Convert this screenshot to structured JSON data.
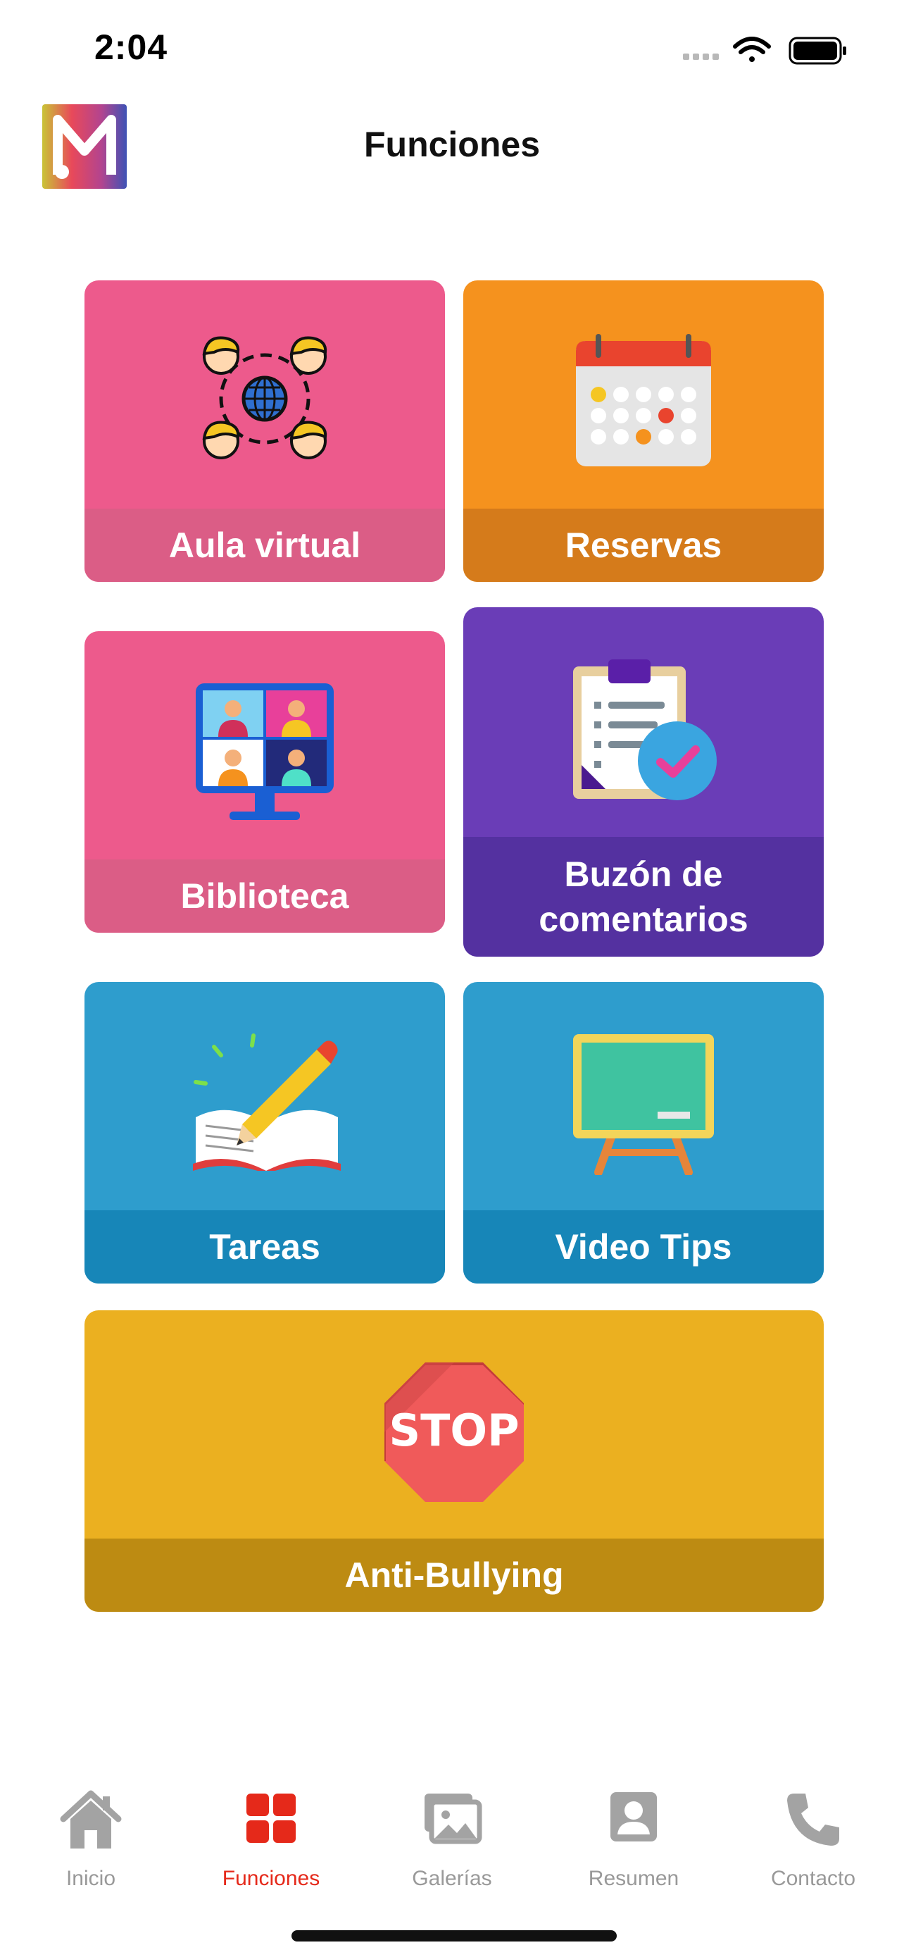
{
  "status_bar": {
    "time": "2:04",
    "icons": [
      "signal-icon",
      "wifi-icon",
      "battery-icon"
    ]
  },
  "header": {
    "title": "Funciones",
    "logo_letter": "M"
  },
  "tiles": [
    {
      "label": "Aula virtual",
      "color": "#ED5A8C",
      "band_color": "#DB5D86",
      "icon": "virtual-classroom-icon"
    },
    {
      "label": "Reservas",
      "color": "#F5921E",
      "band_color": "#D57B1B",
      "icon": "calendar-icon"
    },
    {
      "label": "Biblioteca",
      "color": "#ED5A8C",
      "band_color": "#DB5D86",
      "icon": "video-conference-icon"
    },
    {
      "label_line1": "Buzón de",
      "label_line2": "comentarios",
      "color": "#6A3DB7",
      "band_color": "#5431A0",
      "icon": "clipboard-check-icon"
    },
    {
      "label": "Tareas",
      "color": "#2E9DCD",
      "band_color": "#1786B8",
      "icon": "book-pencil-icon"
    },
    {
      "label": "Video Tips",
      "color": "#2E9DCD",
      "band_color": "#1786B8",
      "icon": "chalkboard-icon"
    },
    {
      "label": "Anti-Bullying",
      "color": "#EBB020",
      "band_color": "#BD8B12",
      "icon": "stop-sign-icon",
      "sign_text": "STOP"
    }
  ],
  "tab_bar": {
    "items": [
      {
        "label": "Inicio",
        "icon": "home-icon"
      },
      {
        "label": "Funciones",
        "icon": "grid-icon",
        "active": true
      },
      {
        "label": "Galerías",
        "icon": "gallery-icon"
      },
      {
        "label": "Resumen",
        "icon": "profile-icon"
      },
      {
        "label": "Contacto",
        "icon": "phone-icon"
      }
    ],
    "active_color": "#E5291A",
    "inactive_color": "#999999"
  }
}
